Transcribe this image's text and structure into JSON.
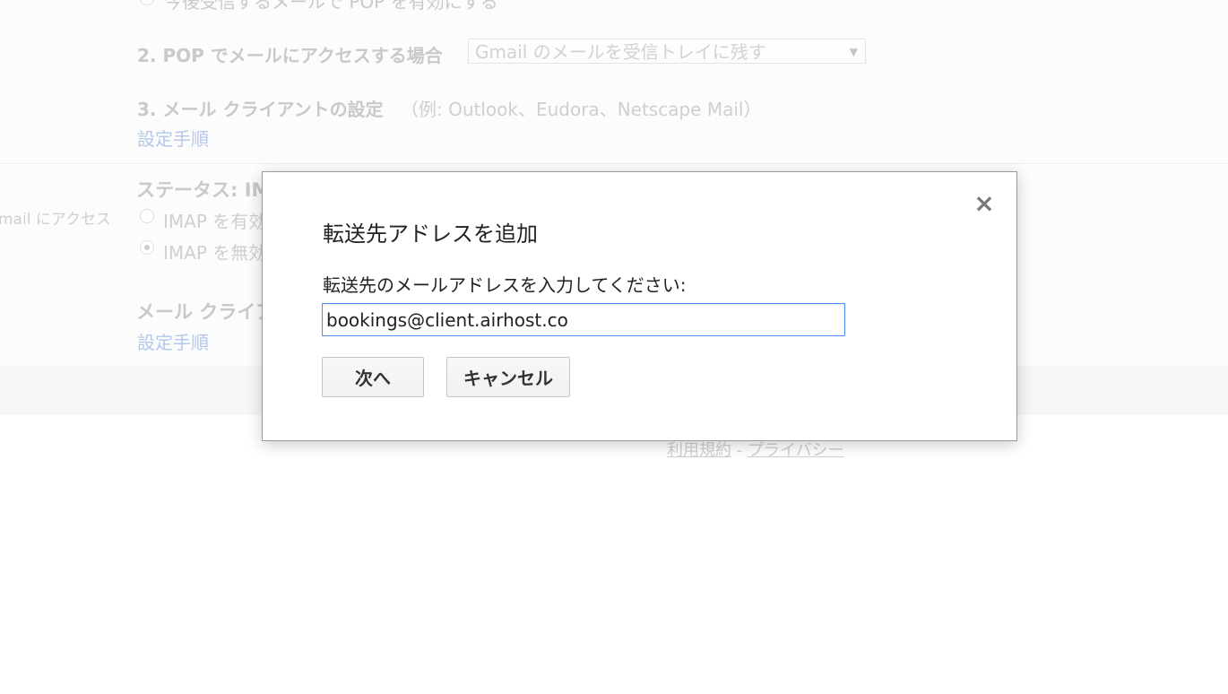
{
  "background": {
    "pop_cut_text": "今後受信するメールで POP を有効にする",
    "pop_access_label": "2. POP でメールにアクセスする場合",
    "pop_access_select_value": "Gmail のメールを受信トレイに残す",
    "client_settings_label": "3. メール クライアントの設定",
    "client_settings_examples": "（例: Outlook、Eudora、Netscape Mail）",
    "setup_instructions_link": "設定手順",
    "imap_side_label": "mail にアクセス",
    "imap_status_label": "ステータス: IM",
    "imap_enable_label": "IMAP を有効",
    "imap_disable_label": "IMAP を無効",
    "imap_client_label": "メール クライア",
    "imap_setup_instructions_link": "設定手順",
    "footer_terms": "利用規約",
    "footer_sep": "-",
    "footer_privacy": "プライバシー"
  },
  "dialog": {
    "title": "転送先アドレスを追加",
    "close_symbol": "×",
    "prompt": "転送先のメールアドレスを入力してください:",
    "email_value": "bookings@client.airhost.co",
    "next_label": "次へ",
    "cancel_label": "キャンセル"
  },
  "colors": {
    "input_focus_border": "#4d90fe",
    "overlay_text": "#cfcfcf",
    "link_muted": "#b5c8ea"
  }
}
